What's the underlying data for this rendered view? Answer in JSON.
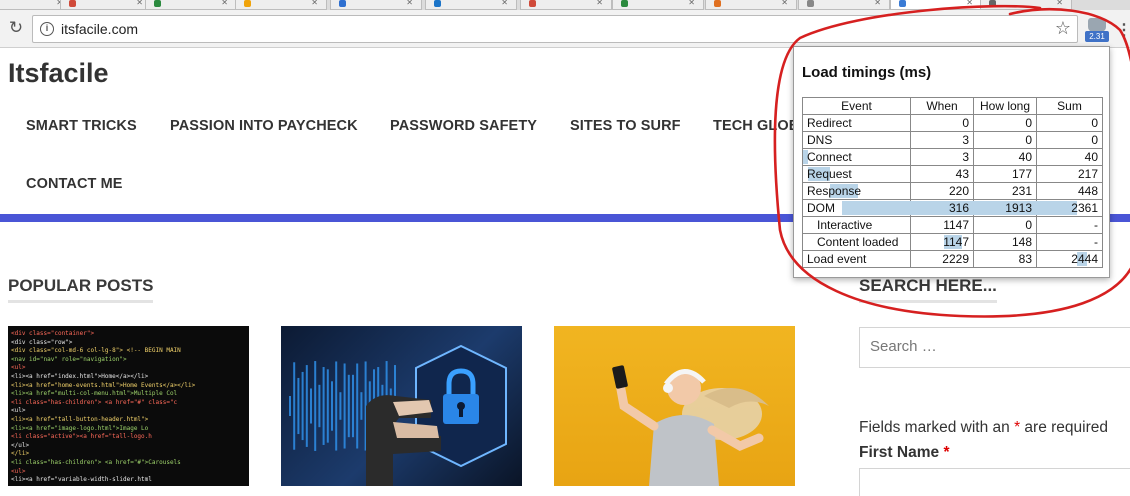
{
  "browser": {
    "url": "itsfacile.com",
    "extension_badge": "2.31"
  },
  "site": {
    "title": "Itsfacile",
    "nav": [
      "SMART TRICKS",
      "PASSION INTO PAYCHECK",
      "PASSWORD SAFETY",
      "SITES TO SURF",
      "TECH GLOBE",
      "CONTACT ME"
    ],
    "popular_heading": "POPULAR POSTS",
    "search_heading": "SEARCH HERE...",
    "search_placeholder": "Search …",
    "fields_note_pre": "Fields marked with an ",
    "fields_note_star": "*",
    "fields_note_post": " are required",
    "first_name_label": "First Name",
    "first_name_star": "*"
  },
  "code_lines": [
    "<div class=\"container\">",
    "  <div class=\"row\">",
    "    <div class=\"col-md-6 col-lg-8\"> <!-- BEGIN MAIN",
    "      <nav id=\"nav\" role=\"navigation\">",
    "        <ul>",
    "          <li><a href=\"index.html\">Home</a></li>",
    "          <li><a href=\"home-events.html\">Home Events</a></li>",
    "          <li><a href=\"multi-col-menu.html\">Multiple Col",
    "          <li class=\"has-children\"> <a href=\"#\" class=\"c",
    "            <ul>",
    "              <li><a href=\"tall-button-header.html\">",
    "              <li><a href=\"image-logo.html\">Image Lo",
    "              <li class=\"active\"><a href=\"tall-logo.h",
    "            </ul>",
    "          </li>",
    "          <li class=\"has-children\"> <a href=\"#\">Carousels",
    "            <ul>",
    "              <li><a href=\"variable-width-slider.html"
  ],
  "popup": {
    "title": "Load timings (ms)",
    "headers": [
      "Event",
      "When",
      "How long",
      "Sum"
    ],
    "rows": [
      {
        "event": "Redirect",
        "when": "0",
        "how_long": "0",
        "sum": "0",
        "indent": false
      },
      {
        "event": "DNS",
        "when": "3",
        "how_long": "0",
        "sum": "0",
        "indent": false
      },
      {
        "event": "Connect",
        "when": "3",
        "how_long": "40",
        "sum": "40",
        "indent": false
      },
      {
        "event": "Request",
        "when": "43",
        "how_long": "177",
        "sum": "217",
        "indent": false
      },
      {
        "event": "Response",
        "when": "220",
        "how_long": "231",
        "sum": "448",
        "indent": false
      },
      {
        "event": "DOM",
        "when": "316",
        "how_long": "1913",
        "sum": "2361",
        "indent": false
      },
      {
        "event": "Interactive",
        "when": "1147",
        "how_long": "0",
        "sum": "-",
        "indent": true
      },
      {
        "event": "Content loaded",
        "when": "1147",
        "how_long": "148",
        "sum": "-",
        "indent": true
      },
      {
        "event": "Load event",
        "when": "2229",
        "how_long": "83",
        "sum": "2444",
        "indent": false
      }
    ],
    "total_ms": 2444
  },
  "colors": {
    "accent_bar": "#4a55d6",
    "annotation": "#d62020",
    "timing_highlight": "#b9d4e8",
    "required": "#dd0000"
  }
}
